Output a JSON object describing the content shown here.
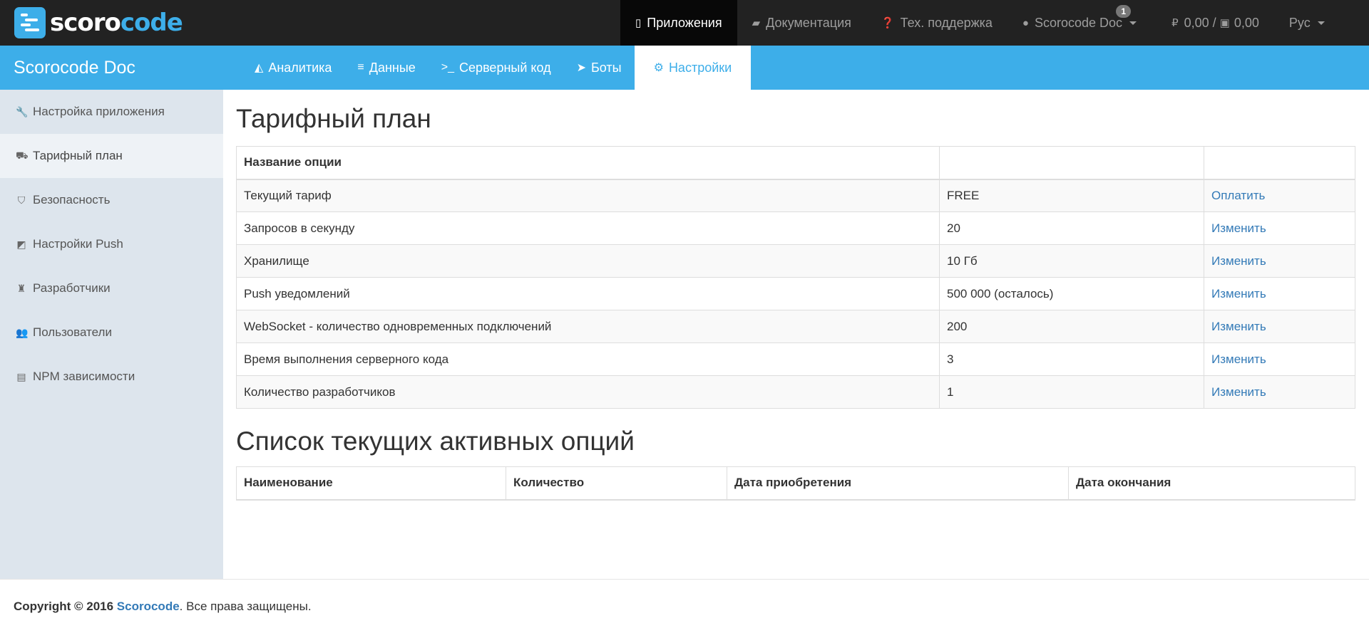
{
  "brand": {
    "logo_part1": "scoro",
    "logo_part2": "code",
    "accent_color": "#3daee9"
  },
  "topnav": {
    "apps": {
      "label": "Приложения",
      "icon": "mobile-icon"
    },
    "docs": {
      "label": "Документация",
      "icon": "book-icon"
    },
    "support": {
      "label": "Тех. поддержка",
      "icon": "question-circle-icon"
    },
    "user": {
      "label": "Scorocode Doc",
      "icon": "user-icon",
      "badge": "1"
    },
    "balance": {
      "rub": "0,00",
      "sep": "/",
      "money": "0,00"
    },
    "lang": {
      "label": "Рус"
    }
  },
  "project": {
    "title": "Scorocode Doc"
  },
  "tabs": [
    {
      "label": "Аналитика",
      "icon": "area-chart-icon"
    },
    {
      "label": "Данные",
      "icon": "database-icon"
    },
    {
      "label": "Серверный код",
      "icon": "terminal-icon"
    },
    {
      "label": "Боты",
      "icon": "telegram-icon"
    },
    {
      "label": "Настройки",
      "icon": "gears-icon"
    }
  ],
  "sidebar": {
    "items": [
      {
        "label": "Настройка приложения",
        "icon": "wrench-icon"
      },
      {
        "label": "Тарифный план",
        "icon": "cart-icon"
      },
      {
        "label": "Безопасность",
        "icon": "shield-icon"
      },
      {
        "label": "Настройки Push",
        "icon": "external-link-icon"
      },
      {
        "label": "Разработчики",
        "icon": "user-secret-icon"
      },
      {
        "label": "Пользователи",
        "icon": "users-icon"
      },
      {
        "label": "NPM зависимости",
        "icon": "file-code-icon"
      }
    ]
  },
  "tariff": {
    "title": "Тарифный план",
    "header": {
      "name": "Название опции",
      "value": "",
      "action": ""
    },
    "rows": [
      {
        "name": "Текущий тариф",
        "value": "FREE",
        "action": "Оплатить"
      },
      {
        "name": "Запросов в секунду",
        "value": "20",
        "action": "Изменить"
      },
      {
        "name": "Хранилище",
        "value": "10 Гб",
        "action": "Изменить"
      },
      {
        "name": "Push уведомлений",
        "value": "500 000 (осталось)",
        "action": "Изменить"
      },
      {
        "name": "WebSocket - количество одновременных подключений",
        "value": "200",
        "action": "Изменить"
      },
      {
        "name": "Время выполнения серверного кода",
        "value": "3",
        "action": "Изменить"
      },
      {
        "name": "Количество разработчиков",
        "value": "1",
        "action": "Изменить"
      }
    ]
  },
  "active_options": {
    "title": "Список текущих активных опций",
    "headers": [
      "Наименование",
      "Количество",
      "Дата приобретения",
      "Дата окончания"
    ]
  },
  "footer": {
    "copyright": "Copyright © 2016",
    "brand": "Scorocode",
    "rights": ". Все права защищены."
  }
}
